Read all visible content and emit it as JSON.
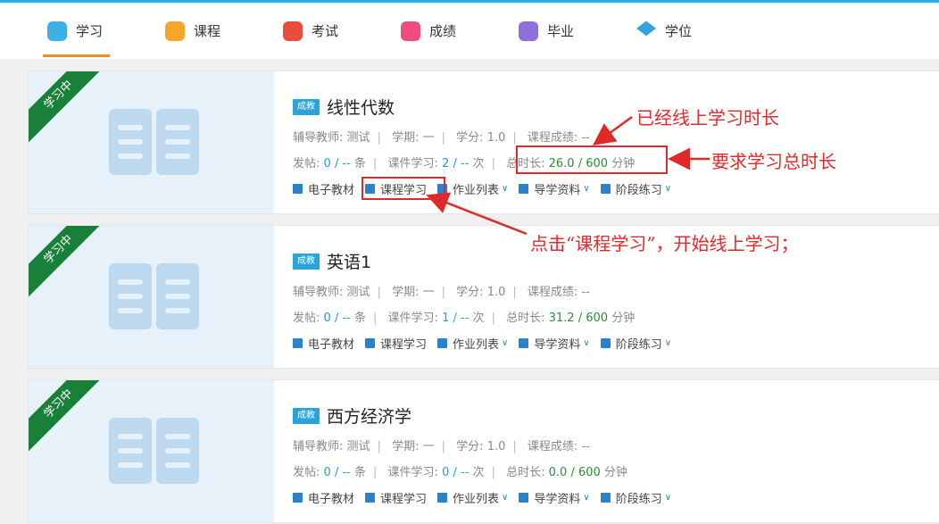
{
  "nav": {
    "items": [
      {
        "label": "学习",
        "icon": "study-icon",
        "active": true
      },
      {
        "label": "课程",
        "icon": "course-icon",
        "active": false
      },
      {
        "label": "考试",
        "icon": "exam-icon",
        "active": false
      },
      {
        "label": "成绩",
        "icon": "score-icon",
        "active": false
      },
      {
        "label": "毕业",
        "icon": "graduation-icon",
        "active": false
      },
      {
        "label": "学位",
        "icon": "degree-icon",
        "active": false
      }
    ],
    "accent_color": "#f08c2e"
  },
  "courses": [
    {
      "ribbon": "学习中",
      "badge": "成教",
      "title": "线性代数",
      "teacher_label": "辅导教师:",
      "teacher": "测试",
      "term_label": "学期:",
      "term": "一",
      "credit_label": "学分:",
      "credit": "1.0",
      "score_label": "课程成绩:",
      "score": "--",
      "posts_label": "发帖:",
      "posts_done": "0",
      "posts_total": "/ --",
      "posts_unit": "条",
      "lesson_label": "课件学习:",
      "lesson_done": "2",
      "lesson_total": "/ --",
      "lesson_unit": "次",
      "duration_label": "总时长:",
      "duration_done": "26.0",
      "duration_total": "/ 600",
      "duration_unit": "分钟"
    },
    {
      "ribbon": "学习中",
      "badge": "成教",
      "title": "英语1",
      "teacher_label": "辅导教师:",
      "teacher": "测试",
      "term_label": "学期:",
      "term": "一",
      "credit_label": "学分:",
      "credit": "1.0",
      "score_label": "课程成绩:",
      "score": "--",
      "posts_label": "发帖:",
      "posts_done": "0",
      "posts_total": "/ --",
      "posts_unit": "条",
      "lesson_label": "课件学习:",
      "lesson_done": "1",
      "lesson_total": "/ --",
      "lesson_unit": "次",
      "duration_label": "总时长:",
      "duration_done": "31.2",
      "duration_total": "/ 600",
      "duration_unit": "分钟"
    },
    {
      "ribbon": "学习中",
      "badge": "成教",
      "title": "西方经济学",
      "teacher_label": "辅导教师:",
      "teacher": "测试",
      "term_label": "学期:",
      "term": "一",
      "credit_label": "学分:",
      "credit": "1.0",
      "score_label": "课程成绩:",
      "score": "--",
      "posts_label": "发帖:",
      "posts_done": "0",
      "posts_total": "/ --",
      "posts_unit": "条",
      "lesson_label": "课件学习:",
      "lesson_done": "0",
      "lesson_total": "/ --",
      "lesson_unit": "次",
      "duration_label": "总时长:",
      "duration_done": "0.0",
      "duration_total": "/ 600",
      "duration_unit": "分钟"
    }
  ],
  "links": {
    "ebook": "电子教材",
    "course_study": "课程学习",
    "homework": "作业列表",
    "guide": "导学资料",
    "practice": "阶段练习"
  },
  "annotations": {
    "online_time": "已经线上学习时长",
    "required_time": "要求学习总时长",
    "click_hint": "点击“课程学习”，开始线上学习；"
  }
}
